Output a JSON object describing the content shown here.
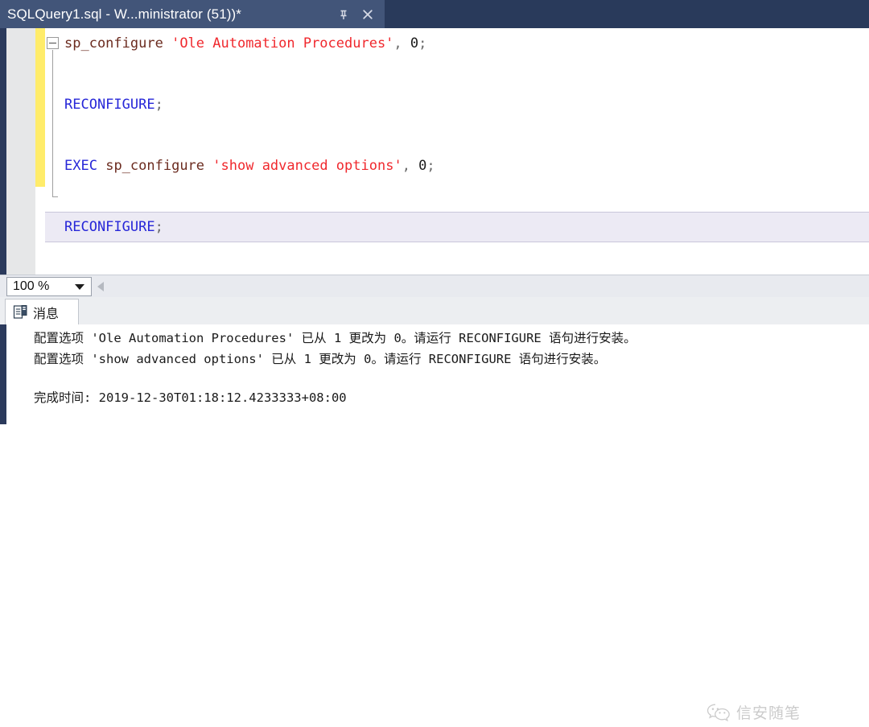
{
  "window": {
    "tab_title": "SQLQuery1.sql - W...ministrator (51))*",
    "pin_icon": "pin-icon",
    "close_icon": "close-icon"
  },
  "editor": {
    "fold_icon": "collapse-minus-icon",
    "lines": [
      {
        "current": false,
        "tokens": [
          {
            "t": "sp_configure",
            "c": "proc"
          },
          {
            "t": " ",
            "c": "plain"
          },
          {
            "t": "'Ole Automation Procedures'",
            "c": "str"
          },
          {
            "t": ",",
            "c": "punct"
          },
          {
            "t": " 0",
            "c": "plain"
          },
          {
            "t": ";",
            "c": "punct"
          }
        ]
      },
      {
        "current": false,
        "tokens": []
      },
      {
        "current": false,
        "tokens": [
          {
            "t": "RECONFIGURE",
            "c": "kw"
          },
          {
            "t": ";",
            "c": "punct"
          }
        ]
      },
      {
        "current": false,
        "tokens": []
      },
      {
        "current": false,
        "tokens": [
          {
            "t": "EXEC",
            "c": "kw"
          },
          {
            "t": " ",
            "c": "plain"
          },
          {
            "t": "sp_configure",
            "c": "proc"
          },
          {
            "t": " ",
            "c": "plain"
          },
          {
            "t": "'show advanced options'",
            "c": "str"
          },
          {
            "t": ",",
            "c": "punct"
          },
          {
            "t": " 0",
            "c": "plain"
          },
          {
            "t": ";",
            "c": "punct"
          }
        ]
      },
      {
        "current": false,
        "tokens": []
      },
      {
        "current": true,
        "tokens": [
          {
            "t": "RECONFIGURE",
            "c": "kw"
          },
          {
            "t": ";",
            "c": "punct"
          }
        ]
      }
    ]
  },
  "zoombar": {
    "zoom_value": "100 %",
    "dropdown_icon": "chevron-down-icon",
    "split_icon": "split-left-arrow-icon"
  },
  "results_tabs": {
    "messages_label": "消息",
    "messages_icon": "messages-server-icon"
  },
  "messages": {
    "lines": [
      "配置选项 'Ole Automation Procedures' 已从 1 更改为 0。请运行 RECONFIGURE 语句进行安装。",
      "配置选项 'show advanced options' 已从 1 更改为 0。请运行 RECONFIGURE 语句进行安装。",
      "",
      "完成时间: 2019-12-30T01:18:12.4233333+08:00"
    ]
  },
  "watermark": {
    "text": "信安随笔",
    "icon": "wechat-icon"
  },
  "colors": {
    "titlebar": "#293a5b",
    "tab_active": "#425579",
    "change_bar": "#ffec6a",
    "keyword": "#2727d8",
    "string": "#f0282d",
    "procedure": "#6b2b1f",
    "current_line": "#eceaf4"
  }
}
